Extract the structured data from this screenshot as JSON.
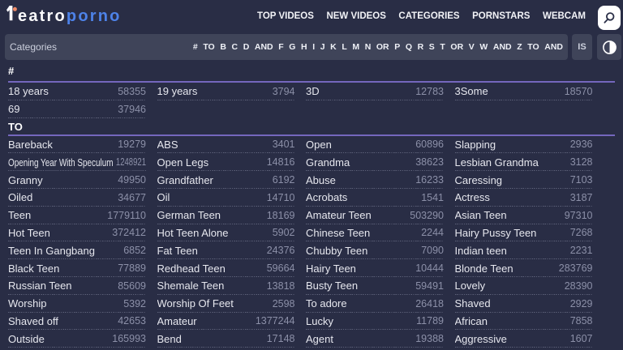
{
  "header": {
    "logo": {
      "mark": "one-glyph-with-orange-dot",
      "text_white": "eatro",
      "text_blue": "porno"
    },
    "nav": [
      "TOP VIDEOS",
      "NEW VIDEOS",
      "CATEGORIES",
      "PORNSTARS",
      "WEBCAM"
    ],
    "search_icon": "magnifier"
  },
  "toolbar": {
    "title": "Categories",
    "alphabet": [
      "#",
      "TO",
      "B",
      "C",
      "D",
      "AND",
      "F",
      "G",
      "H",
      "I",
      "J",
      "K",
      "L",
      "M",
      "N",
      "OR",
      "P",
      "Q",
      "R",
      "S",
      "T",
      "OR",
      "V",
      "W",
      "AND",
      "Z",
      "TO",
      "AND"
    ],
    "language_label": "IS",
    "theme_icon": "contrast-half-circle"
  },
  "sections": [
    {
      "title": "#",
      "items": [
        {
          "label": "18 years",
          "count": "58355"
        },
        {
          "label": "69",
          "count": "37946"
        },
        {
          "label": "19 years",
          "count": "3794"
        },
        {
          "label": "3D",
          "count": "12783"
        },
        {
          "label": "3Some",
          "count": "18570"
        }
      ]
    },
    {
      "title": "TO",
      "items": [
        {
          "label": "Bareback",
          "count": "19279"
        },
        {
          "label": "Opening Year With Speculum",
          "count": "1248921"
        },
        {
          "label": "Granny",
          "count": "49950"
        },
        {
          "label": "Oiled",
          "count": "34677"
        },
        {
          "label": "Teen",
          "count": "1779110"
        },
        {
          "label": "Hot Teen",
          "count": "372412"
        },
        {
          "label": "Teen In Gangbang",
          "count": "6852"
        },
        {
          "label": "Black Teen",
          "count": "77889"
        },
        {
          "label": "Russian Teen",
          "count": "85609"
        },
        {
          "label": "Worship",
          "count": "5392"
        },
        {
          "label": "Shaved off",
          "count": "42653"
        },
        {
          "label": "Outside",
          "count": "165993"
        },
        {
          "label": "ABS",
          "count": "3401"
        },
        {
          "label": "Open Legs",
          "count": "14816"
        },
        {
          "label": "Grandfather",
          "count": "6192"
        },
        {
          "label": "Oil",
          "count": "14710"
        },
        {
          "label": "German Teen",
          "count": "18169"
        },
        {
          "label": "Hot Teen Alone",
          "count": "5902"
        },
        {
          "label": "Fat Teen",
          "count": "24376"
        },
        {
          "label": "Redhead Teen",
          "count": "59664"
        },
        {
          "label": "Shemale Teen",
          "count": "13818"
        },
        {
          "label": "Worship Of Feet",
          "count": "2598"
        },
        {
          "label": "Amateur",
          "count": "1377244"
        },
        {
          "label": "Bend",
          "count": "17148"
        },
        {
          "label": "Open",
          "count": "60896"
        },
        {
          "label": "Grandma",
          "count": "38623"
        },
        {
          "label": "Abuse",
          "count": "16233"
        },
        {
          "label": "Acrobats",
          "count": "1541"
        },
        {
          "label": "Amateur Teen",
          "count": "503290"
        },
        {
          "label": "Chinese Teen",
          "count": "2244"
        },
        {
          "label": "Chubby Teen",
          "count": "7090"
        },
        {
          "label": "Hairy Teen",
          "count": "10444"
        },
        {
          "label": "Busty Teen",
          "count": "59491"
        },
        {
          "label": "To adore",
          "count": "26418"
        },
        {
          "label": "Lucky",
          "count": "11789"
        },
        {
          "label": "Agent",
          "count": "19388"
        },
        {
          "label": "Slapping",
          "count": "2936"
        },
        {
          "label": "Lesbian Grandma",
          "count": "3128"
        },
        {
          "label": "Caressing",
          "count": "7103"
        },
        {
          "label": "Actress",
          "count": "3187"
        },
        {
          "label": "Asian Teen",
          "count": "97310"
        },
        {
          "label": "Hairy Pussy Teen",
          "count": "7268"
        },
        {
          "label": "Indian teen",
          "count": "2231"
        },
        {
          "label": "Blonde Teen",
          "count": "283769"
        },
        {
          "label": "Lovely",
          "count": "28390"
        },
        {
          "label": "Shaved",
          "count": "2929"
        },
        {
          "label": "African",
          "count": "7858"
        },
        {
          "label": "Aggressive",
          "count": "1607"
        }
      ]
    }
  ],
  "colors": {
    "background": "#292d45",
    "panel": "#3f4459",
    "accent_purple": "#7569c5",
    "logo_blue": "#4d82e8",
    "logo_orange": "#f08a67",
    "count_gray": "#8c90a8"
  }
}
